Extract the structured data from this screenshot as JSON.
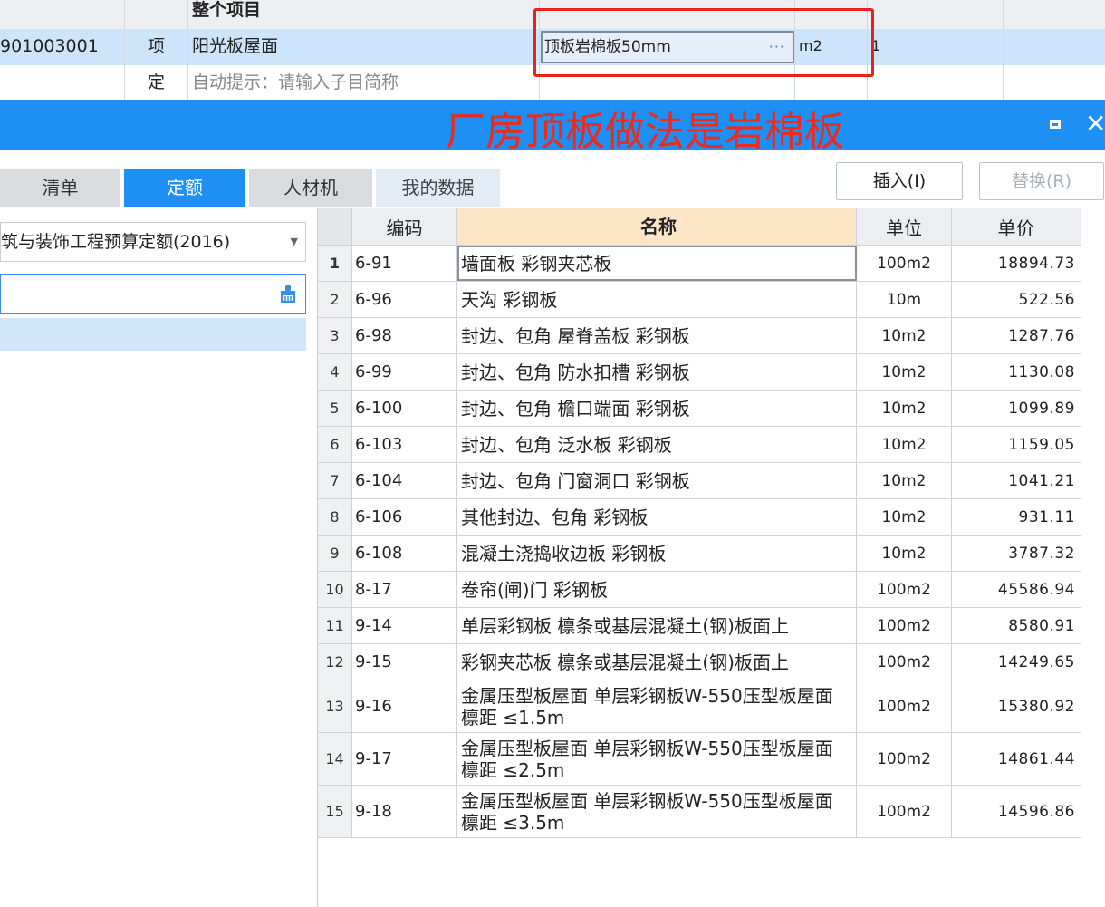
{
  "top_grid": {
    "header_row": {
      "title": "整个项目"
    },
    "item_row": {
      "code": "901003001",
      "type": "项",
      "name": "阳光板屋面",
      "spec": "顶板岩棉板50mm",
      "spec_button": "···",
      "unit": "m2",
      "qty": "1"
    },
    "quota_row": {
      "type": "定",
      "hint": "自动提示：请输入子目简称"
    }
  },
  "annotation": "厂房顶板做法是岩棉板",
  "window_controls": {
    "maximize_icon": "maximize-icon",
    "close_label": "✕"
  },
  "tabs": [
    {
      "label": "清单"
    },
    {
      "label": "定额",
      "active": true
    },
    {
      "label": "人材机"
    },
    {
      "label": "我的数据"
    }
  ],
  "actions": {
    "insert": "插入(I)",
    "replace": "替换(R)"
  },
  "left_panel": {
    "quota_library": "筑与装饰工程预算定额(2016)",
    "search_icon": "clear-brush-icon"
  },
  "table": {
    "headers": {
      "code": "编码",
      "name": "名称",
      "unit": "单位",
      "price": "单价"
    },
    "rows": [
      {
        "idx": "1",
        "code": "6-91",
        "name": "墙面板 彩钢夹芯板",
        "unit": "100m2",
        "price": "18894.73"
      },
      {
        "idx": "2",
        "code": "6-96",
        "name": "天沟 彩钢板",
        "unit": "10m",
        "price": "522.56"
      },
      {
        "idx": "3",
        "code": "6-98",
        "name": "封边、包角 屋脊盖板 彩钢板",
        "unit": "10m2",
        "price": "1287.76"
      },
      {
        "idx": "4",
        "code": "6-99",
        "name": "封边、包角 防水扣槽 彩钢板",
        "unit": "10m2",
        "price": "1130.08"
      },
      {
        "idx": "5",
        "code": "6-100",
        "name": "封边、包角 檐口端面 彩钢板",
        "unit": "10m2",
        "price": "1099.89"
      },
      {
        "idx": "6",
        "code": "6-103",
        "name": "封边、包角 泛水板 彩钢板",
        "unit": "10m2",
        "price": "1159.05"
      },
      {
        "idx": "7",
        "code": "6-104",
        "name": "封边、包角 门窗洞口 彩钢板",
        "unit": "10m2",
        "price": "1041.21"
      },
      {
        "idx": "8",
        "code": "6-106",
        "name": "其他封边、包角 彩钢板",
        "unit": "10m2",
        "price": "931.11"
      },
      {
        "idx": "9",
        "code": "6-108",
        "name": "混凝土浇捣收边板 彩钢板",
        "unit": "10m2",
        "price": "3787.32"
      },
      {
        "idx": "10",
        "code": "8-17",
        "name": "卷帘(闸)门 彩钢板",
        "unit": "100m2",
        "price": "45586.94"
      },
      {
        "idx": "11",
        "code": "9-14",
        "name": "单层彩钢板 檩条或基层混凝土(钢)板面上",
        "unit": "100m2",
        "price": "8580.91"
      },
      {
        "idx": "12",
        "code": "9-15",
        "name": "彩钢夹芯板 檩条或基层混凝土(钢)板面上",
        "unit": "100m2",
        "price": "14249.65"
      },
      {
        "idx": "13",
        "code": "9-16",
        "name": "金属压型板屋面 单层彩钢板W-550压型板屋面 檩距 ≤1.5m",
        "unit": "100m2",
        "price": "15380.92"
      },
      {
        "idx": "14",
        "code": "9-17",
        "name": "金属压型板屋面 单层彩钢板W-550压型板屋面 檩距 ≤2.5m",
        "unit": "100m2",
        "price": "14861.44"
      },
      {
        "idx": "15",
        "code": "9-18",
        "name": "金属压型板屋面 单层彩钢板W-550压型板屋面 檩距 ≤3.5m",
        "unit": "100m2",
        "price": "14596.86"
      }
    ]
  },
  "colors": {
    "accent": "#1e90f5",
    "annotation": "#ee2a1a",
    "selected_row": "#cce5fa",
    "name_header": "#fde6c8"
  }
}
